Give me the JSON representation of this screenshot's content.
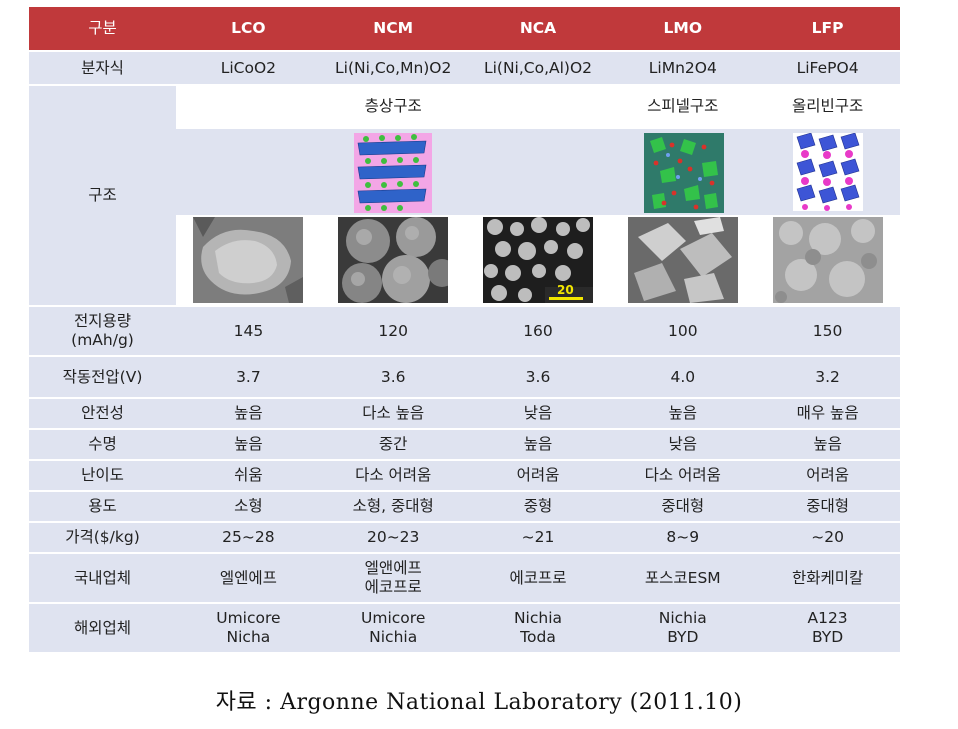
{
  "header": [
    "구분",
    "LCO",
    "NCM",
    "NCA",
    "LMO",
    "LFP"
  ],
  "rows": {
    "formula": {
      "label": "분자식",
      "values": [
        "LiCoO2",
        "Li(Ni,Co,Mn)O2",
        "Li(Ni,Co,Al)O2",
        "LiMn2O4",
        "LiFePO4"
      ]
    },
    "structure": {
      "label": "구조",
      "names": [
        "",
        "층상구조",
        "",
        "스피넬구조",
        "올리빈구조"
      ],
      "crystal_images": [
        "",
        "layered-crystal-structure-image",
        "",
        "spinel-crystal-structure-image",
        "olivine-crystal-structure-image"
      ],
      "sem_images": [
        "LCO-SEM-image",
        "NCM-SEM-image",
        "NCA-SEM-image",
        "LMO-SEM-image",
        "LFP-SEM-image"
      ],
      "nca_scale_text": "20"
    },
    "capacity": {
      "label_line1": "전지용량",
      "label_line2": "(mAh/g)",
      "values": [
        "145",
        "120",
        "160",
        "100",
        "150"
      ]
    },
    "voltage": {
      "label": "작동전압(V)",
      "values": [
        "3.7",
        "3.6",
        "3.6",
        "4.0",
        "3.2"
      ]
    },
    "safety": {
      "label": "안전성",
      "values": [
        "높음",
        "다소 높음",
        "낮음",
        "높음",
        "매우 높음"
      ]
    },
    "lifespan": {
      "label": "수명",
      "values": [
        "높음",
        "중간",
        "높음",
        "낮음",
        "높음"
      ]
    },
    "difficulty": {
      "label": "난이도",
      "values": [
        "쉬움",
        "다소 어려움",
        "어려움",
        "다소 어려움",
        "어려움"
      ]
    },
    "usage": {
      "label": "용도",
      "values": [
        "소형",
        "소형, 중대형",
        "중형",
        "중대형",
        "중대형"
      ]
    },
    "price": {
      "label": "가격($/kg)",
      "values": [
        "25~28",
        "20~23",
        "~21",
        "8~9",
        "~20"
      ]
    },
    "domestic": {
      "label": "국내업체",
      "values": [
        [
          "엘엔에프"
        ],
        [
          "엘앤에프",
          "에코프로"
        ],
        [
          "에코프로"
        ],
        [
          "포스코ESM"
        ],
        [
          "한화케미칼"
        ]
      ]
    },
    "overseas": {
      "label": "해외업체",
      "values": [
        [
          "Umicore",
          "Nicha"
        ],
        [
          "Umicore",
          "Nichia"
        ],
        [
          "Nichia",
          "Toda"
        ],
        [
          "Nichia",
          "BYD"
        ],
        [
          "A123",
          "BYD"
        ]
      ]
    }
  },
  "caption": "자료 : Argonne National Laboratory (2011.10)"
}
